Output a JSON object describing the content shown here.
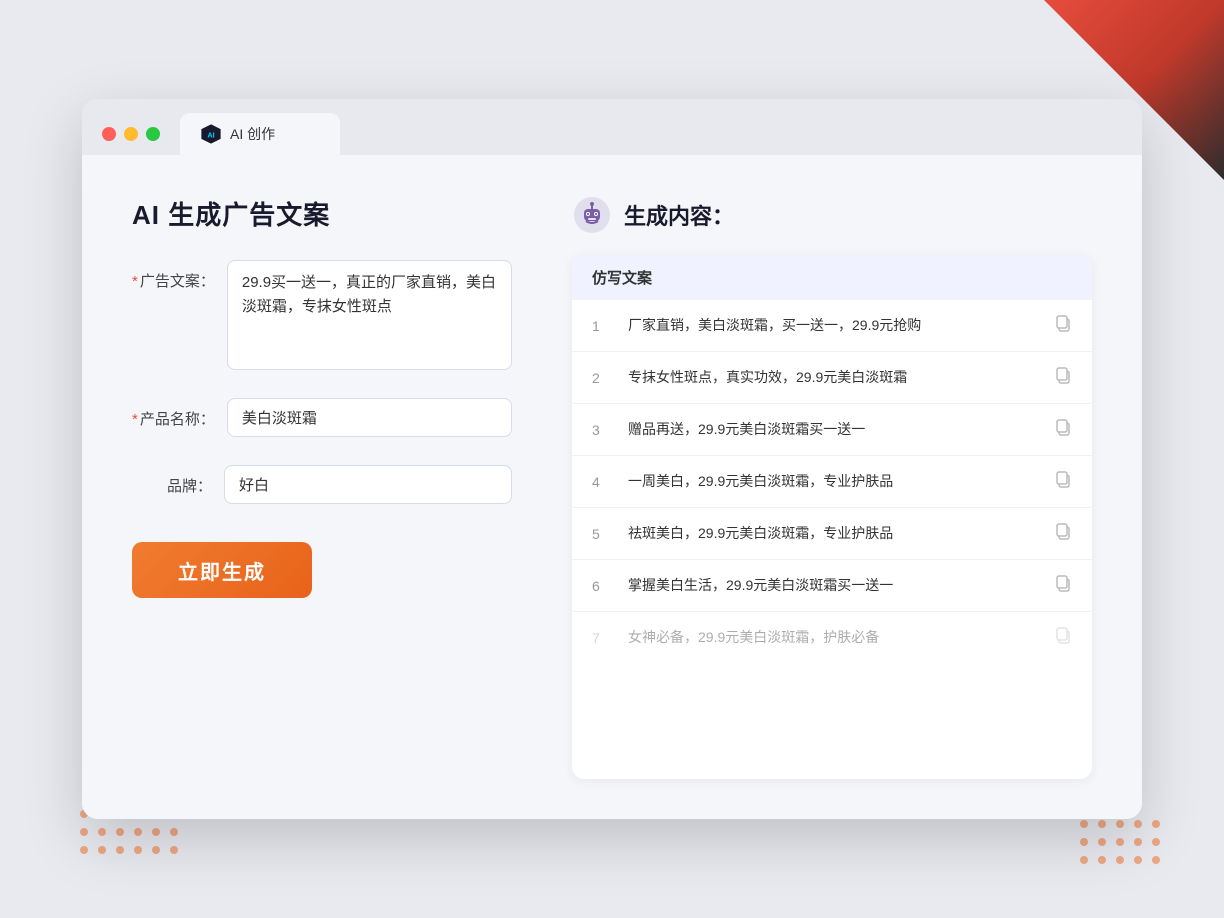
{
  "window": {
    "tab_title": "AI 创作"
  },
  "page": {
    "title": "AI 生成广告文案"
  },
  "form": {
    "ad_copy_label": "广告文案：",
    "ad_copy_required": "*",
    "ad_copy_value": "29.9买一送一，真正的厂家直销，美白淡斑霜，专抹女性斑点",
    "product_name_label": "产品名称：",
    "product_name_required": "*",
    "product_name_value": "美白淡斑霜",
    "brand_label": "品牌：",
    "brand_value": "好白",
    "generate_button": "立即生成"
  },
  "result": {
    "title": "生成内容：",
    "column_header": "仿写文案",
    "items": [
      {
        "num": "1",
        "text": "厂家直销，美白淡斑霜，买一送一，29.9元抢购",
        "faded": false
      },
      {
        "num": "2",
        "text": "专抹女性斑点，真实功效，29.9元美白淡斑霜",
        "faded": false
      },
      {
        "num": "3",
        "text": "赠品再送，29.9元美白淡斑霜买一送一",
        "faded": false
      },
      {
        "num": "4",
        "text": "一周美白，29.9元美白淡斑霜，专业护肤品",
        "faded": false
      },
      {
        "num": "5",
        "text": "祛斑美白，29.9元美白淡斑霜，专业护肤品",
        "faded": false
      },
      {
        "num": "6",
        "text": "掌握美白生活，29.9元美白淡斑霜买一送一",
        "faded": false
      },
      {
        "num": "7",
        "text": "女神必备，29.9元美白淡斑霜，护肤必备",
        "faded": true
      }
    ]
  },
  "colors": {
    "orange": "#f07c30",
    "purple": "#6c7adf",
    "red": "#e74c3c"
  }
}
